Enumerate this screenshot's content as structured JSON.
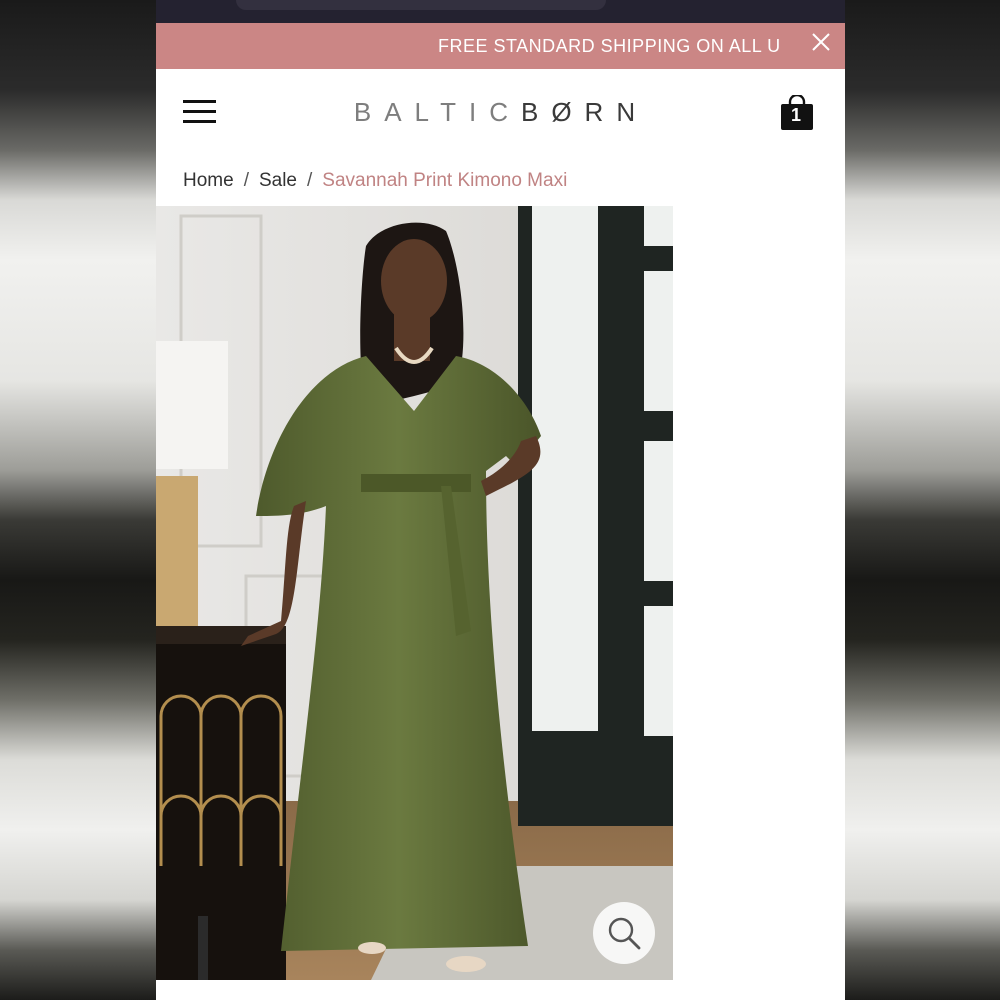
{
  "promo": {
    "text": "FREE STANDARD SHIPPING ON ALL U",
    "close_icon": "close-icon"
  },
  "header": {
    "menu_icon": "hamburger-menu-icon",
    "logo_light": "BALTIC",
    "logo_strong": "BØRN",
    "cart_icon": "shopping-bag-icon",
    "cart_count": "1"
  },
  "breadcrumb": {
    "home": "Home",
    "separator": "/",
    "sale": "Sale",
    "current": "Savannah Print Kimono Maxi"
  },
  "product": {
    "image_description": "Model wearing olive green satin kimono maxi dress",
    "zoom_icon": "magnifier-icon"
  },
  "colors": {
    "promo_bg": "#cb8685",
    "accent": "#c08383",
    "dress": "#5e6b38"
  }
}
